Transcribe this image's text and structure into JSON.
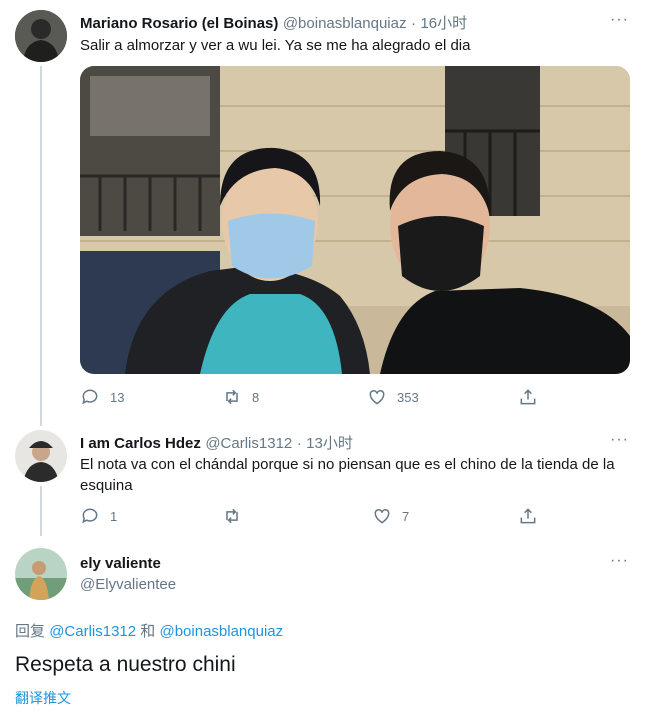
{
  "tweet1": {
    "name": "Mariano Rosario (el Boinas)",
    "handle": "@boinasblanquiaz",
    "time": "16小时",
    "more": "···",
    "text": "Salir a almorzar y ver a wu lei. Ya se me ha alegrado el dia",
    "replies": "13",
    "retweets": "8",
    "likes": "353"
  },
  "tweet2": {
    "name": "I am Carlos Hdez",
    "handle": "@Carlis1312",
    "time": "13小时",
    "more": "···",
    "text": "El nota va con el chándal porque si no piensan que es el chino de la tienda de la esquina",
    "replies": "1",
    "retweets": "",
    "likes": "7"
  },
  "tweet3": {
    "name": "ely valiente",
    "handle": "@Elyvalientee",
    "more": "···",
    "reply_prefix": "回复",
    "reply_to_1": "@Carlis1312",
    "reply_and": "和",
    "reply_to_2": "@boinasblanquiaz",
    "text": "Respeta a nuestro chini",
    "translate": "翻译推文"
  },
  "colors": {
    "text": "#14171a",
    "secondary": "#657786",
    "link": "#1b95e0",
    "thread_line": "#cfd9de"
  }
}
